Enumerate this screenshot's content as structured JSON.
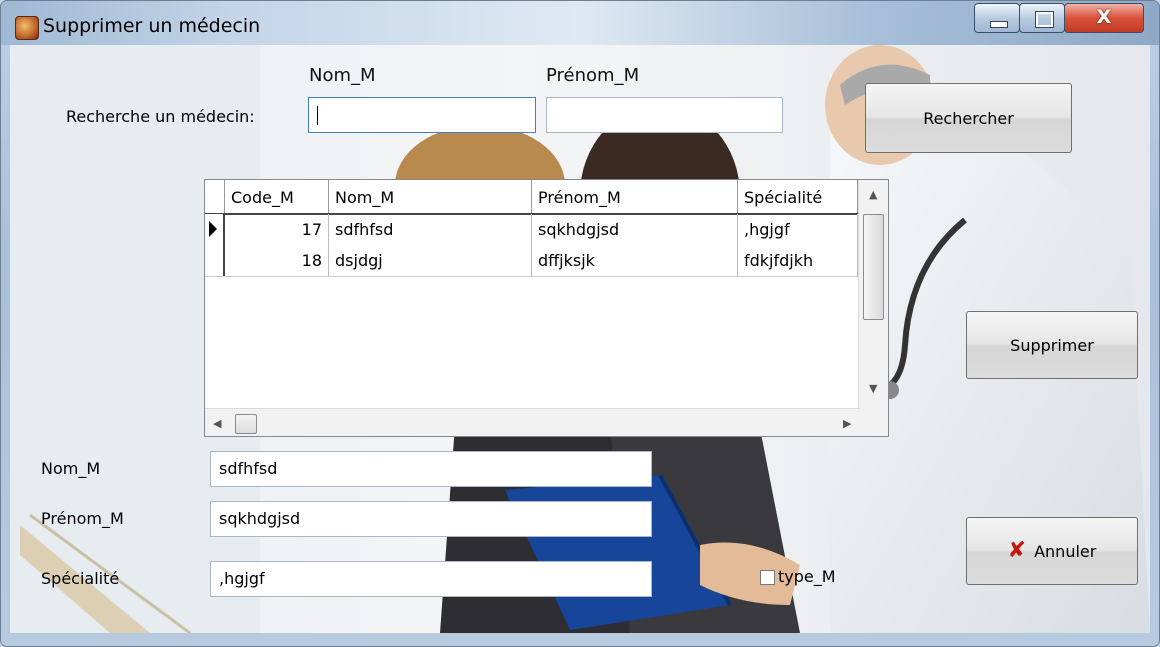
{
  "window": {
    "title": "Supprimer un médecin"
  },
  "search": {
    "label": "Recherche un médecin:",
    "nom_header": "Nom_M",
    "prenom_header": "Prénom_M",
    "nom_value": "",
    "prenom_value": "",
    "button": "Rechercher"
  },
  "grid": {
    "columns": [
      "Code_M",
      "Nom_M",
      "Prénom_M",
      "Spécialité"
    ],
    "rows": [
      {
        "code": "17",
        "nom": "sdfhfsd",
        "prenom": "sqkhdgjsd",
        "specialite": ",hgjgf",
        "selected": true
      },
      {
        "code": "18",
        "nom": "dsjdgj",
        "prenom": "dffjksjk",
        "specialite": "fdkjfdjkh",
        "selected": false
      }
    ]
  },
  "form": {
    "nom_label": "Nom_M",
    "nom_value": "sdfhfsd",
    "prenom_label": "Prénom_M",
    "prenom_value": "sqkhdgjsd",
    "specialite_label": "Spécialité",
    "specialite_value": ",hgjgf",
    "type_label": "type_M",
    "type_checked": false
  },
  "buttons": {
    "delete": "Supprimer",
    "cancel": "Annuler"
  },
  "icons": {
    "app": "app-icon",
    "cancel": "x-icon"
  }
}
